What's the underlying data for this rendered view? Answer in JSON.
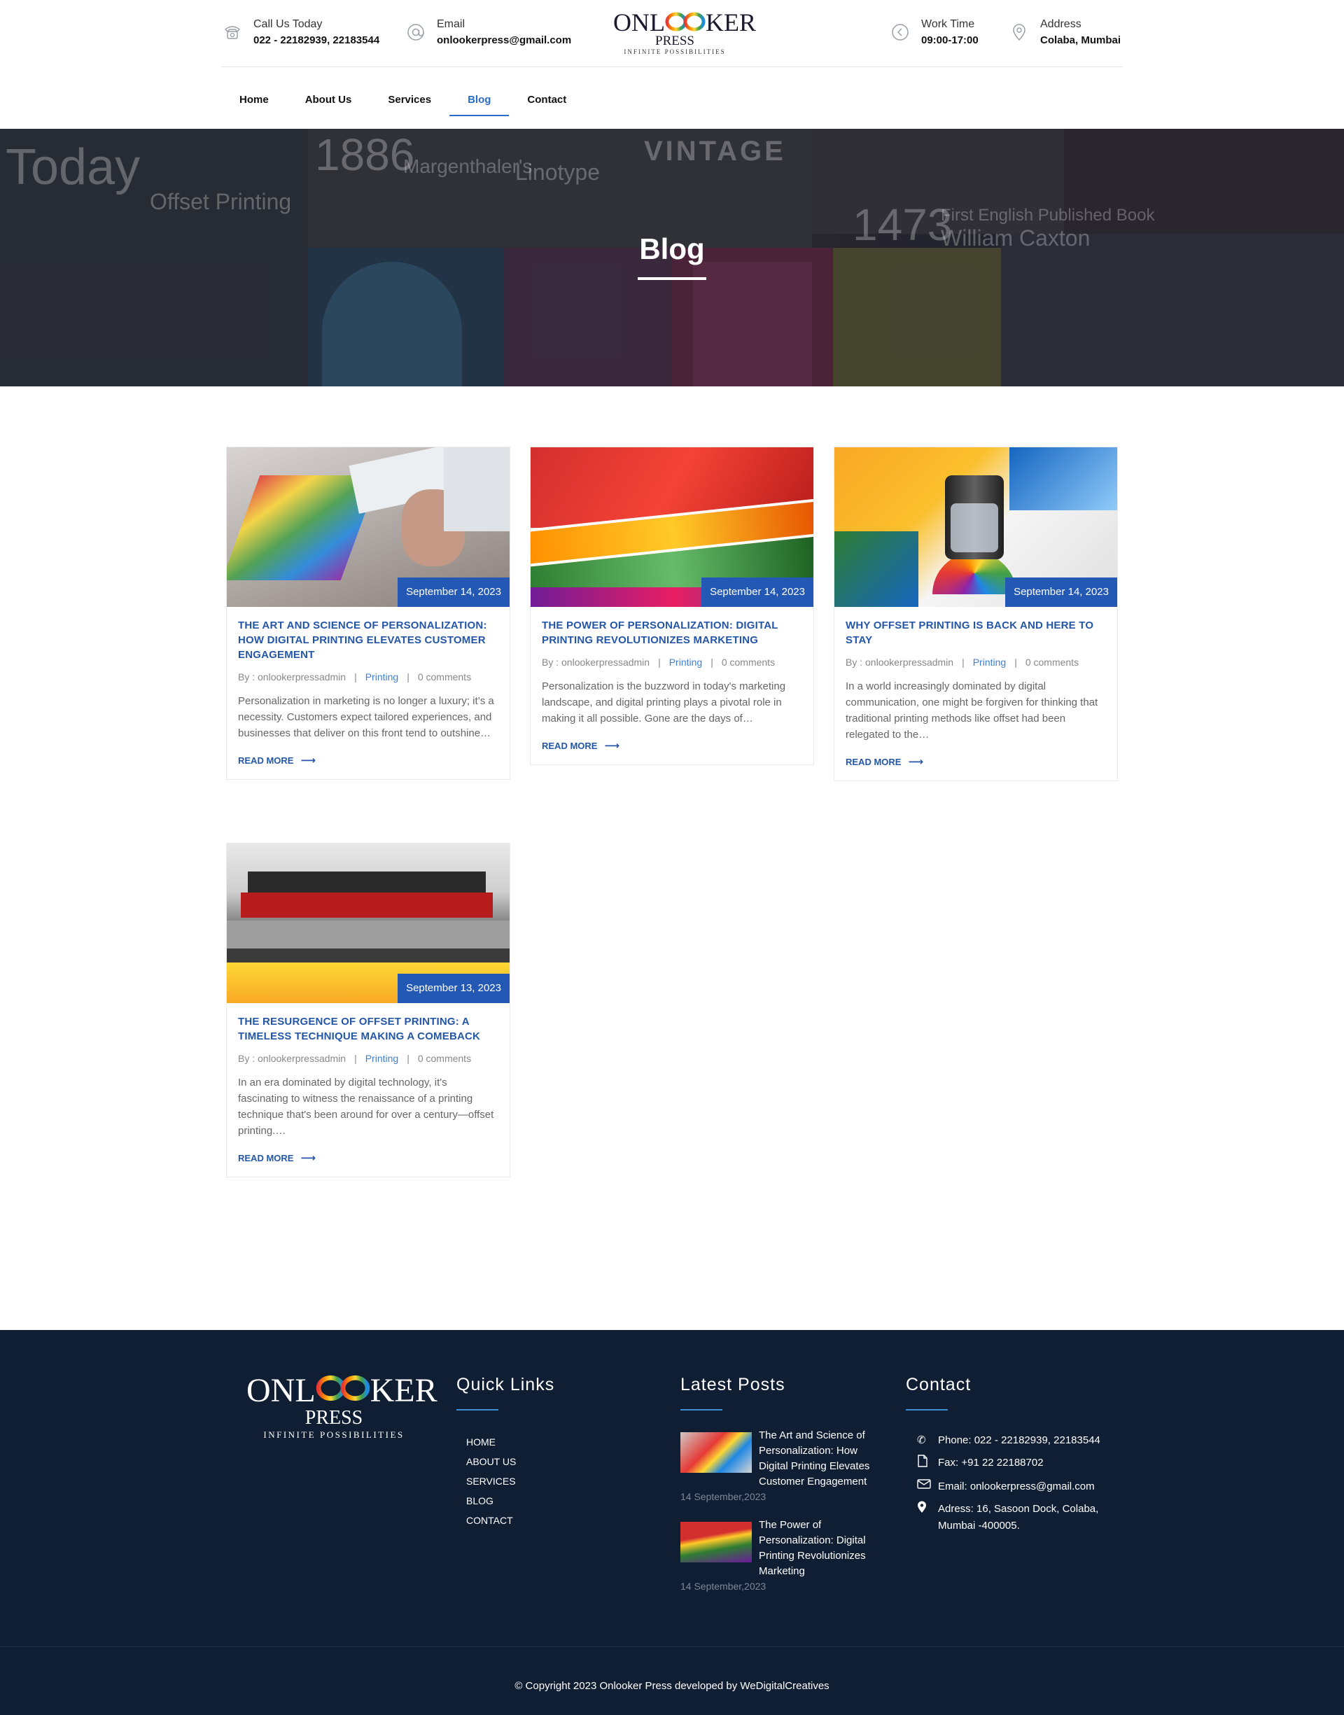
{
  "header": {
    "call": {
      "label": "Call Us Today",
      "value": "022 - 22182939, 22183544",
      "icon": "phone-icon"
    },
    "email": {
      "label": "Email",
      "value": "onlookerpress@gmail.com",
      "icon": "at-icon"
    },
    "work": {
      "label": "Work Time",
      "value": "09:00-17:00",
      "icon": "clock-icon"
    },
    "address": {
      "label": "Address",
      "value": "Colaba, Mumbai",
      "icon": "location-pin-icon"
    },
    "logo": {
      "pre": "ONL",
      "post": "KER",
      "line2": "PRESS",
      "tagline": "INFINITE POSSIBILITIES"
    }
  },
  "nav": {
    "items": [
      {
        "label": "Home"
      },
      {
        "label": "About Us"
      },
      {
        "label": "Services"
      },
      {
        "label": "Blog",
        "active": true
      },
      {
        "label": "Contact"
      }
    ]
  },
  "hero": {
    "title": "Blog",
    "background_words": [
      "Today",
      "Offset Printing",
      "1886",
      "Margenthaler's",
      "Linotype",
      "VINTAGE",
      "1473",
      "First English Published Book",
      "William Caxton"
    ]
  },
  "posts": [
    {
      "date": "September 14, 2023",
      "title": "The Art and Science of Personalization: How Digital Printing Elevates Customer Engagement",
      "author": "By : onlookerpressadmin",
      "category": "Printing",
      "comments": "0 comments",
      "excerpt": "Personalization in marketing is no longer a luxury; it’s a necessity. Customers expect tailored experiences, and businesses that deliver on this front tend to outshine…",
      "read_more": "READ MORE"
    },
    {
      "date": "September 14, 2023",
      "title": "The Power of Personalization: Digital Printing Revolutionizes Marketing",
      "author": "By : onlookerpressadmin",
      "category": "Printing",
      "comments": "0 comments",
      "excerpt": "Personalization is the buzzword in today's marketing landscape, and digital printing plays a pivotal role in making it all possible. Gone are the days of…",
      "read_more": "READ MORE"
    },
    {
      "date": "September 14, 2023",
      "title": "Why Offset Printing is Back and Here to Stay",
      "author": "By : onlookerpressadmin",
      "category": "Printing",
      "comments": "0 comments",
      "excerpt": "In a world increasingly dominated by digital communication, one might be forgiven for thinking that traditional printing methods like offset had been relegated to the…",
      "read_more": "READ MORE"
    },
    {
      "date": "September 13, 2023",
      "title": "The Resurgence of Offset Printing: A Timeless Technique Making a Comeback",
      "author": "By : onlookerpressadmin",
      "category": "Printing",
      "comments": "0 comments",
      "excerpt": "In an era dominated by digital technology, it's fascinating to witness the renaissance of a printing technique that's been around for over a century—offset printing.…",
      "read_more": "READ MORE"
    }
  ],
  "footer": {
    "logo": {
      "pre": "ONL",
      "post": "KER",
      "line2": "PRESS",
      "tagline": "INFINITE POSSIBILITIES"
    },
    "quick_links": {
      "heading": "Quick Links",
      "items": [
        "Home",
        "About Us",
        "Services",
        "Blog",
        "Contact"
      ]
    },
    "latest_posts": {
      "heading": "Latest Posts",
      "items": [
        {
          "title": "The Art and Science of Personalization: How Digital Printing Elevates Customer Engagement",
          "date": "14 September,2023"
        },
        {
          "title": "The Power of Personalization: Digital Printing Revolutionizes Marketing",
          "date": "14 September,2023"
        }
      ]
    },
    "contact": {
      "heading": "Contact",
      "phone": "Phone: 022 - 22182939, 22183544",
      "fax": "Fax: +91 22 22188702",
      "email": "Email: onlookerpress@gmail.com",
      "address": "Adress: 16, Sasoon Dock, Colaba, Mumbai -400005."
    },
    "copyright": "© Copyright 2023 Onlooker Press developed by WeDigitalCreatives"
  },
  "colors": {
    "accent": "#2456a8",
    "date_badge": "#2359b5",
    "footer_bg": "#0f1e33",
    "link": "#3d7fd6"
  }
}
